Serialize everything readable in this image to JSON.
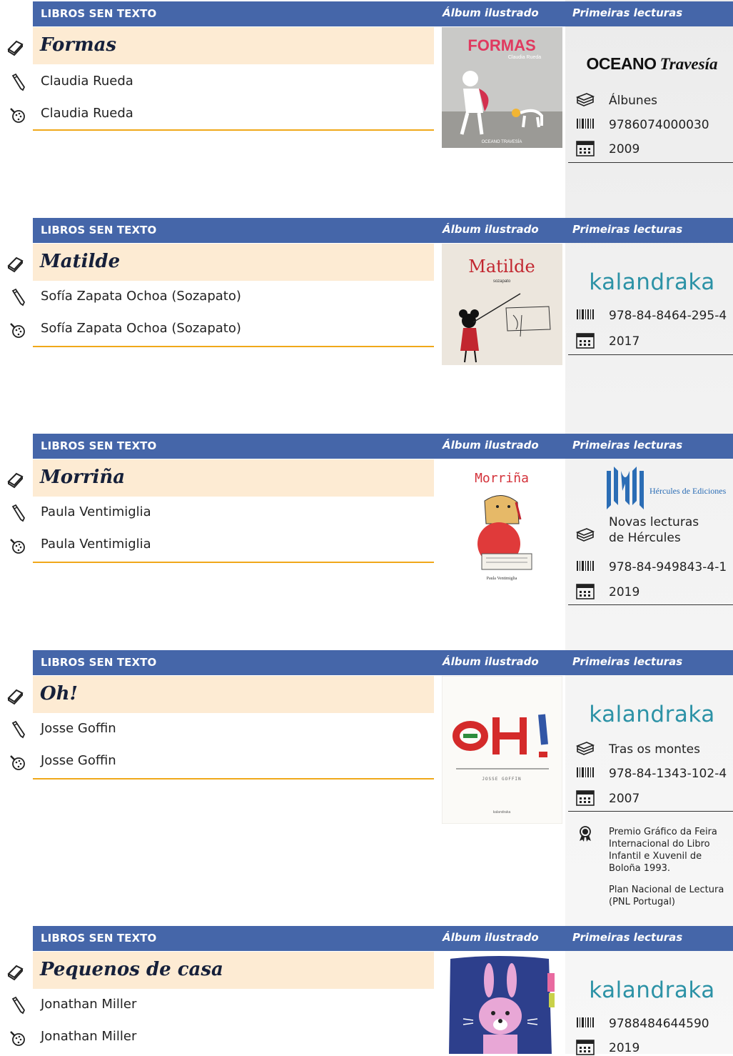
{
  "entries": [
    {
      "category": "LIBROS SEN TEXTO",
      "genre": "Álbum ilustrado",
      "level": "Primeiras lecturas",
      "title": "Formas",
      "author": "Claudia Rueda",
      "illustrator": "Claudia Rueda",
      "cover_title": "FORMAS",
      "cover_subtitle": "Claudia Rueda",
      "cover_footer": "OCEANO TRAVESÍA",
      "publisher_a": "OCEANO",
      "publisher_b": "Travesía",
      "collection": "Álbunes",
      "isbn": "9786074000030",
      "year": "2009"
    },
    {
      "category": "LIBROS SEN TEXTO",
      "genre": "Álbum ilustrado",
      "level": "Primeiras lecturas",
      "title": "Matilde",
      "author": "Sofía Zapata Ochoa (Sozapato)",
      "illustrator": "Sofía Zapata Ochoa (Sozapato)",
      "cover_title": "Matilde",
      "cover_subtitle": "sozapato",
      "publisher": "kalandraka",
      "isbn": "978-84-8464-295-4",
      "year": "2017"
    },
    {
      "category": "LIBROS SEN TEXTO",
      "genre": "Álbum ilustrado",
      "level": "Primeiras lecturas",
      "title": "Morriña",
      "author": "Paula Ventimiglia",
      "illustrator": "Paula Ventimiglia",
      "cover_title": "Morriña",
      "cover_subtitle": "Paula Ventimiglia",
      "publisher": "Hércules de Ediciones",
      "collection_line1": "Novas lecturas",
      "collection_line2": "de Hércules",
      "isbn": "978-84-949843-4-1",
      "year": "2019"
    },
    {
      "category": "LIBROS SEN TEXTO",
      "genre": "Álbum ilustrado",
      "level": "Primeiras lecturas",
      "title": "Oh!",
      "author": "Josse Goffin",
      "illustrator": "Josse Goffin",
      "cover_subtitle": "JOSSE GOFFIN",
      "cover_footer": "kalandraka",
      "publisher": "kalandraka",
      "collection": "Tras os montes",
      "isbn": "978-84-1343-102-4",
      "year": "2007",
      "award_1": "Premio Gráfico da Feira Internacional do Libro Infantil e Xuvenil de Boloña 1993.",
      "award_2": "Plan Nacional de Lectura (PNL Portugal)"
    },
    {
      "category": "LIBROS SEN TEXTO",
      "genre": "Álbum ilustrado",
      "level": "Primeiras lecturas",
      "title": "Pequenos de casa",
      "author": "Jonathan Miller",
      "illustrator": "Jonathan Miller",
      "publisher": "kalandraka",
      "isbn": "9788484644590",
      "year": "2019"
    }
  ],
  "colors": {
    "header_bg": "#4566a9",
    "title_bg": "#fdebd3",
    "rule": "#f0a81a",
    "kalandraka": "#2c92a6",
    "hercules": "#2b6db5"
  },
  "icons": [
    "book-icon",
    "pencil-icon",
    "palette-icon",
    "books-stack-icon",
    "barcode-icon",
    "calendar-icon",
    "award-medal-icon"
  ]
}
